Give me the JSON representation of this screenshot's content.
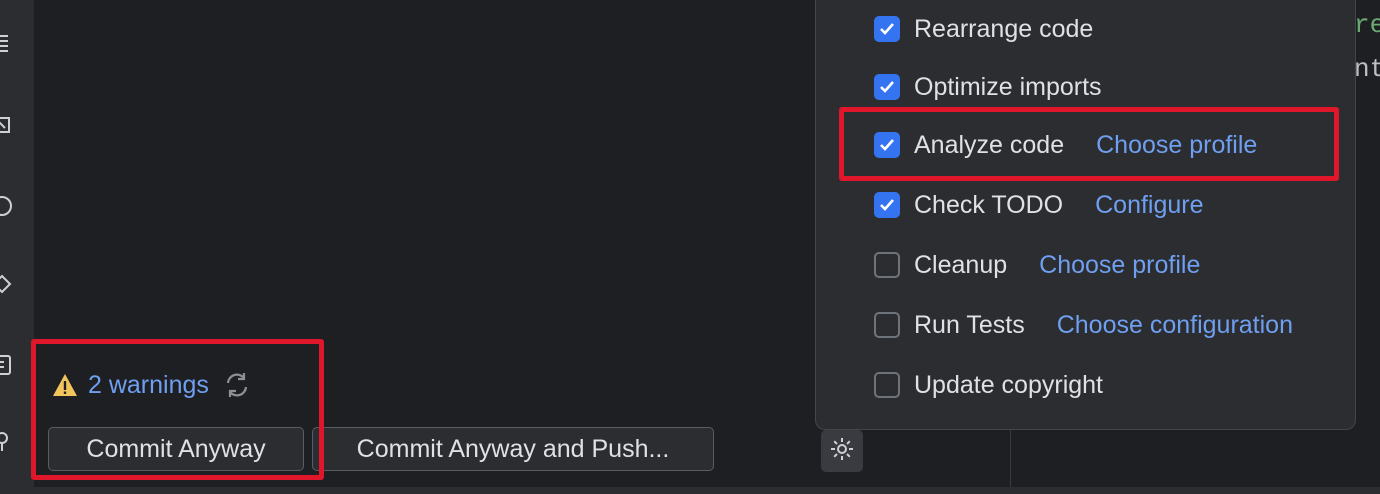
{
  "toolstrip": {
    "icons": [
      "structure-icon",
      "pull-requests-icon",
      "history-icon",
      "git-icon",
      "terminal-icon",
      "key-icon"
    ]
  },
  "commit": {
    "warnings_label": "2 warnings",
    "commit_anyway_label": "Commit Anyway",
    "commit_anyway_push_label": "Commit Anyway and Push..."
  },
  "options": [
    {
      "label": "Rearrange code",
      "checked": true,
      "link": ""
    },
    {
      "label": "Optimize imports",
      "checked": true,
      "link": ""
    },
    {
      "label": "Analyze code",
      "checked": true,
      "link": "Choose profile"
    },
    {
      "label": "Check TODO",
      "checked": true,
      "link": "Configure"
    },
    {
      "label": "Cleanup",
      "checked": false,
      "link": "Choose profile"
    },
    {
      "label": "Run Tests",
      "checked": false,
      "link": "Choose configuration"
    },
    {
      "label": "Update copyright",
      "checked": false,
      "link": ""
    }
  ],
  "editor": {
    "line1": "re",
    "line2": "nt"
  },
  "colors": {
    "accent": "#3574f0",
    "link": "#6f9ff0",
    "highlight": "#e0162b",
    "warning": "#f2c55c"
  }
}
